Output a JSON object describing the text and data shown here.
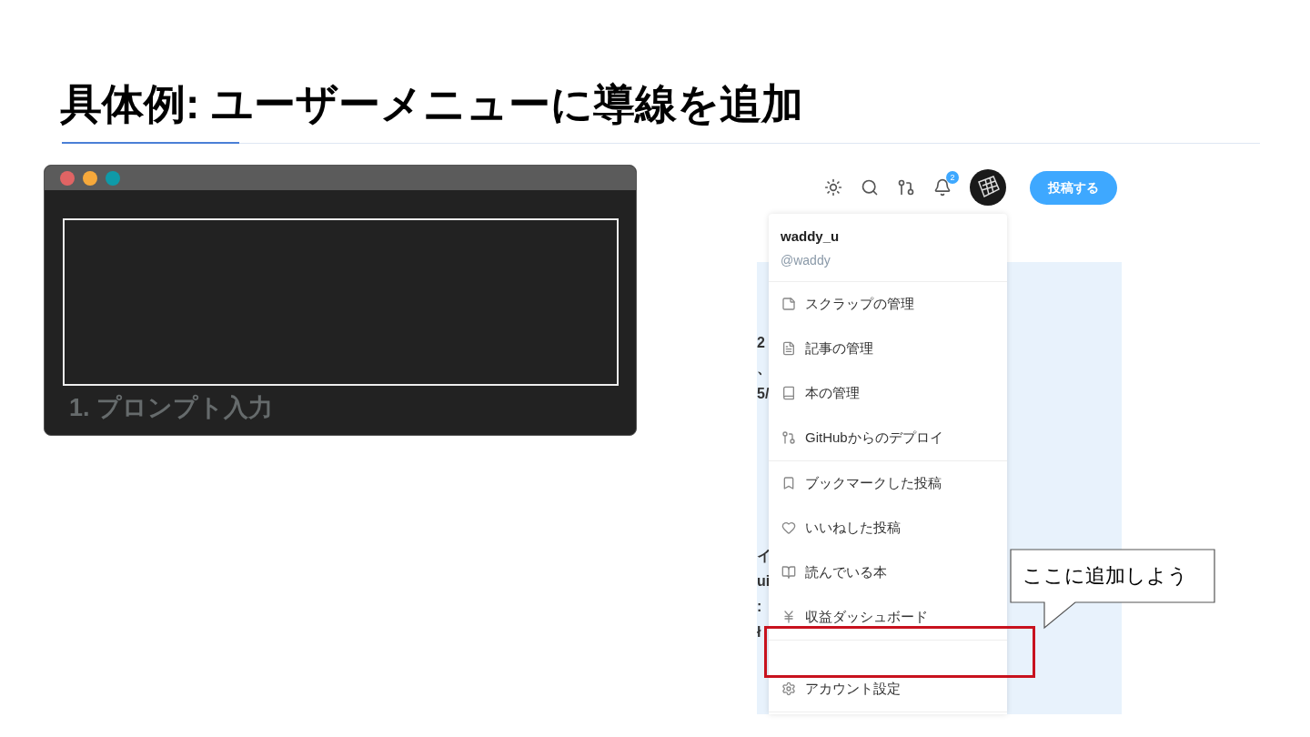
{
  "slide": {
    "title": "具体例: ユーザーメニューに導線を追加"
  },
  "terminal": {
    "caption": "1. プロンプト入力"
  },
  "header": {
    "icons": [
      {
        "kind": "theme"
      },
      {
        "kind": "search"
      },
      {
        "kind": "git"
      },
      {
        "kind": "bell",
        "badge": "2"
      },
      {
        "kind": "avatar"
      }
    ],
    "post_button": "投稿する"
  },
  "background_fragments": [
    "2",
    "、",
    "5/",
    "イ",
    "ui",
    ":",
    "ł"
  ],
  "menu": {
    "user_name": "waddy_u",
    "handle": "@waddy",
    "groups": [
      [
        {
          "label": "スクラップの管理",
          "kind": "scrap"
        },
        {
          "label": "記事の管理",
          "kind": "article"
        },
        {
          "label": "本の管理",
          "kind": "book"
        },
        {
          "label": "GitHubからのデプロイ",
          "kind": "deploy"
        }
      ],
      [
        {
          "label": "ブックマークした投稿",
          "kind": "bookmark"
        },
        {
          "label": "いいねした投稿",
          "kind": "like"
        },
        {
          "label": "読んでいる本",
          "kind": "reading"
        },
        {
          "label": "収益ダッシュボード",
          "kind": "revenue"
        }
      ],
      [
        {
          "label": "アカウント設定",
          "kind": "settings"
        }
      ]
    ]
  },
  "callout": {
    "text": "ここに追加しよう"
  }
}
